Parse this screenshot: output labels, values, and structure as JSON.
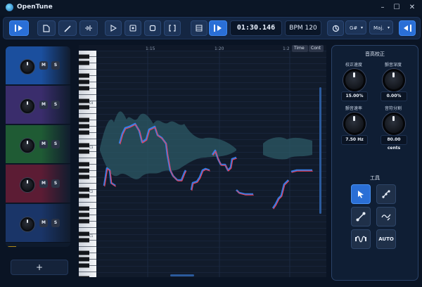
{
  "app": {
    "title": "OpenTune"
  },
  "window": {
    "minimize": "–",
    "maximize": "☐",
    "close": "✕"
  },
  "toolbar": {
    "time": "01:30.146",
    "bpm": "BPM 120",
    "key": "G#",
    "scale": "Maj.",
    "caret": "▾"
  },
  "timeline": {
    "markers": [
      "1:15",
      "1:20",
      "1:2"
    ],
    "time_button": "Time",
    "cont_button": "Cont"
  },
  "tracks": {
    "items": [
      {
        "color": "#1b4f9e",
        "mute": "M",
        "solo": "S"
      },
      {
        "color": "#3a2d6c",
        "mute": "M",
        "solo": "S"
      },
      {
        "color": "#1f5b34",
        "mute": "M",
        "solo": "S"
      },
      {
        "color": "#5c1c34",
        "mute": "M",
        "solo": "S"
      },
      {
        "color": "#1a3568",
        "mute": "M",
        "solo": "S"
      }
    ],
    "add_label": "+"
  },
  "piano": {
    "c_labels": [
      "C4",
      "C3",
      "C2",
      "C1"
    ]
  },
  "panel": {
    "title": "音高校正",
    "knobs": [
      {
        "label": "校正速度",
        "value": "15.00%"
      },
      {
        "label": "颤音深度",
        "value": "0.00%"
      },
      {
        "label": "颤音速率",
        "value": "7.50 Hz"
      },
      {
        "label": "音符分割",
        "value": "80.00 cents"
      }
    ],
    "tools_title": "工具",
    "auto_label": "AUTO"
  },
  "colors": {
    "accent": "#2a6fd6",
    "pitch_blue": "#3d8bff",
    "pitch_red": "#ff3b4e",
    "waveform": "#2c5a66"
  }
}
